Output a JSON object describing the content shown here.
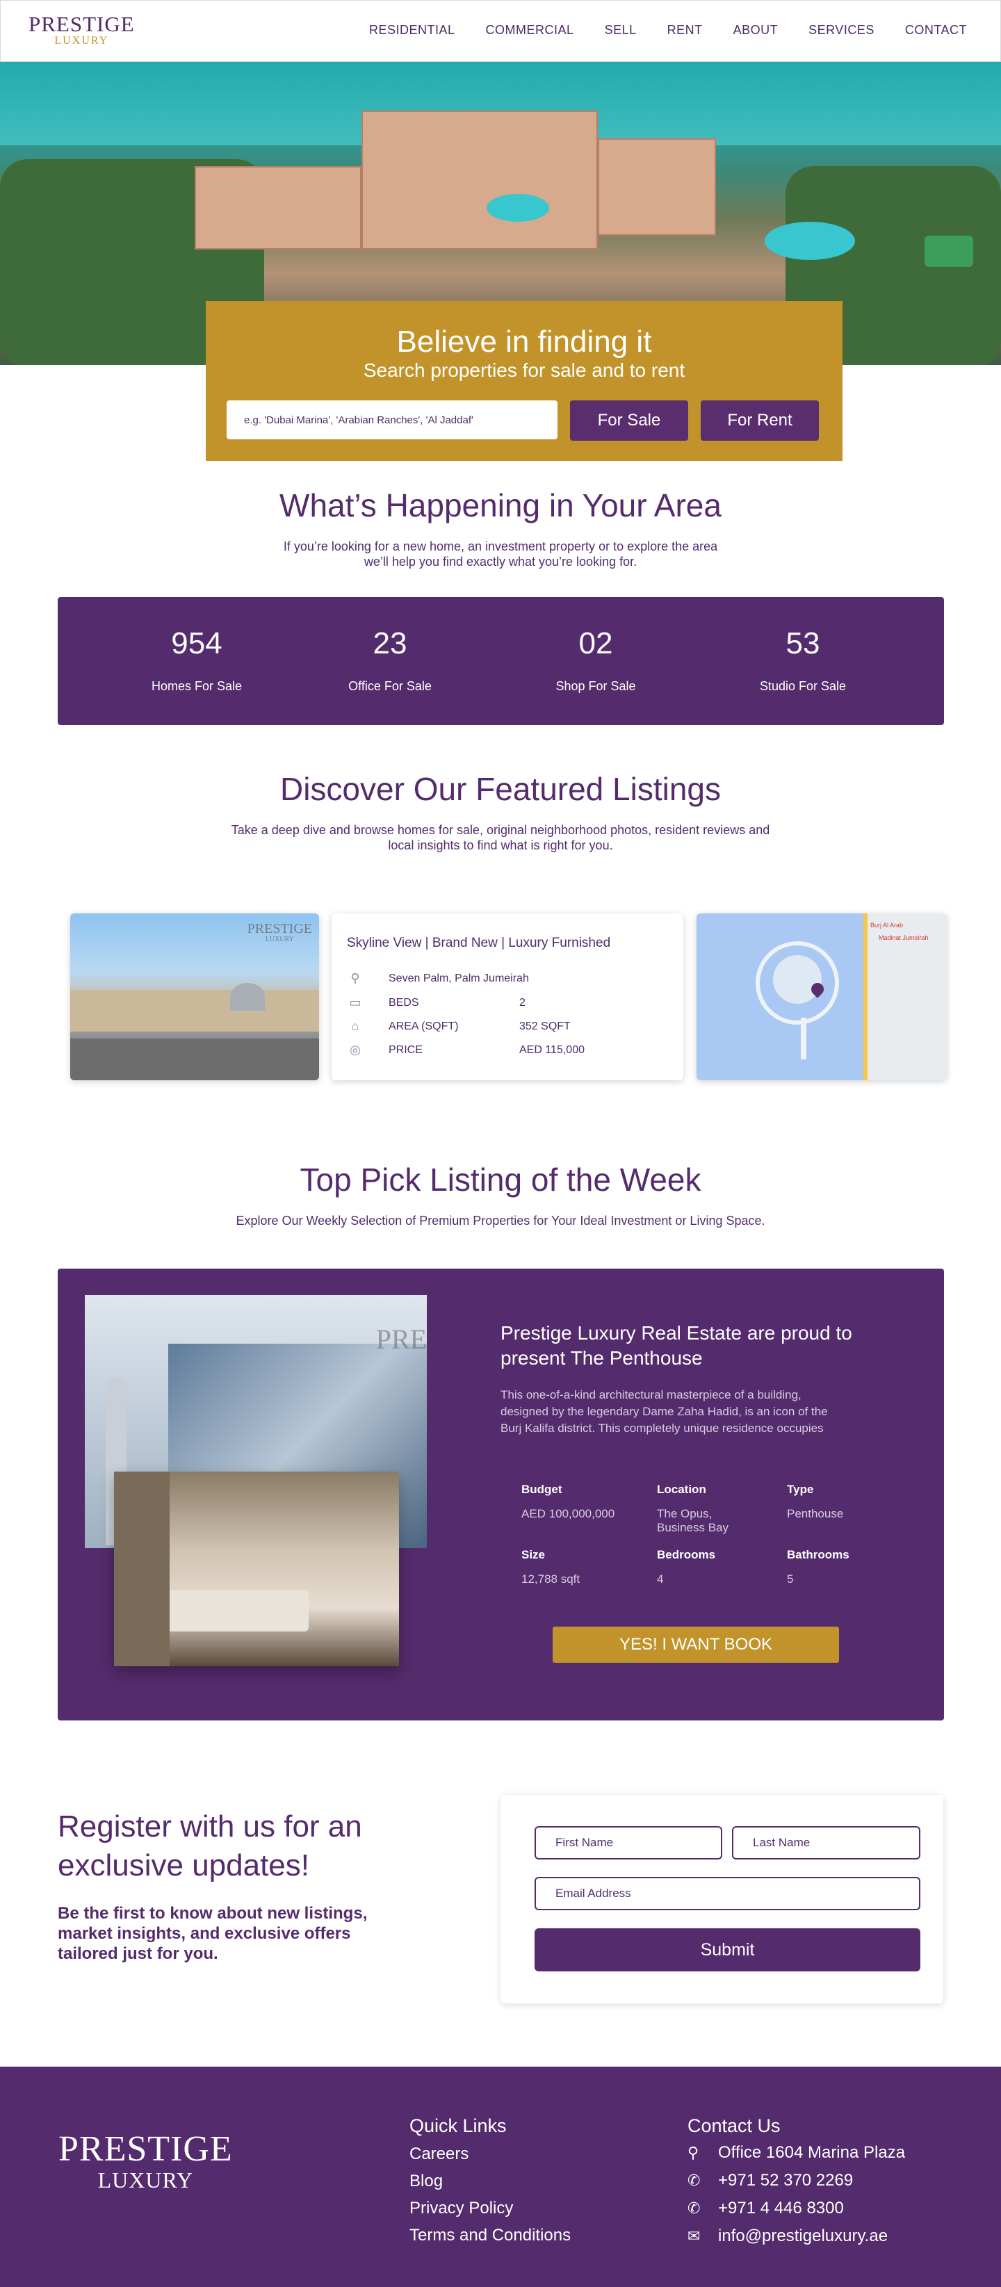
{
  "brand": {
    "logo_top": "PRESTIGE",
    "logo_bottom": "LUXURY"
  },
  "nav": {
    "items": [
      "RESIDENTIAL",
      "COMMERCIAL",
      "SELL",
      "RENT",
      "ABOUT",
      "SERVICES",
      "CONTACT"
    ]
  },
  "hero": {
    "title": "Believe in finding it",
    "subtitle": "Search properties for sale and to rent",
    "search_placeholder": "e.g. 'Dubai Marina', 'Arabian Ranches', 'Al Jaddaf'",
    "for_sale": "For Sale",
    "for_rent": "For Rent"
  },
  "area": {
    "title": "What’s Happening in Your Area",
    "sub1": "If you’re looking for a new home, an investment property or to explore the area",
    "sub2": "we’ll help you find exactly what you’re looking for."
  },
  "stats": [
    {
      "num": "954",
      "label": "Homes For Sale"
    },
    {
      "num": "23",
      "label": "Office For Sale"
    },
    {
      "num": "02",
      "label": "Shop For Sale"
    },
    {
      "num": "53",
      "label": "Studio For Sale"
    }
  ],
  "featured": {
    "title": "Discover Our Featured Listings",
    "sub1": "Take a deep dive and browse homes for sale, original neighborhood photos, resident reviews and",
    "sub2": "local insights to find what is right for you.",
    "watermark_top": "PRESTIGE",
    "watermark_bottom": "LUXURY",
    "listing_title": "Skyline View | Brand New | Luxury Furnished",
    "location": "Seven Palm, Palm Jumeirah",
    "beds_label": "BEDS",
    "beds_value": "2",
    "area_label": "AREA (SQFT)",
    "area_value": "352 SQFT",
    "price_label": "PRICE",
    "price_value": "AED 115,000",
    "map_labels": [
      "Madinat Jumeirah",
      "Burj Al Arab"
    ]
  },
  "toppick": {
    "title": "Top Pick Listing of the Week",
    "sub": "Explore Our Weekly Selection of Premium Properties for Your Ideal Investment or Living Space.",
    "heading1": "Prestige Luxury Real Estate are proud to",
    "heading2": "present The Penthouse",
    "desc1": "This one-of-a-kind architectural masterpiece of a building,",
    "desc2": "designed by the legendary Dame Zaha Hadid, is an icon of the",
    "desc3": "Burj Kalifa district. This completely unique residence occupies",
    "budget_k": "Budget",
    "budget_v": "AED 100,000,000",
    "location_k": "Location",
    "location_v1": "The Opus,",
    "location_v2": "Business Bay",
    "type_k": "Type",
    "type_v": "Penthouse",
    "size_k": "Size",
    "size_v": "12,788 sqft",
    "bedrooms_k": "Bedrooms",
    "bedrooms_v": "4",
    "bathrooms_k": "Bathrooms",
    "bathrooms_v": "5",
    "watermark": "PRE",
    "cta": "YES! I WANT BOOK"
  },
  "register": {
    "title1": "Register with us for an",
    "title2": "exclusive updates!",
    "sub1": "Be the first to know about new listings,",
    "sub2": "market insights, and exclusive offers",
    "sub3": "tailored just for you.",
    "first_name": "First Name",
    "last_name": "Last Name",
    "email": "Email Address",
    "submit": "Submit"
  },
  "footer": {
    "logo_top": "PRESTIGE",
    "logo_bottom": "LUXURY",
    "quick_title": "Quick Links",
    "links": [
      "Careers",
      "Blog",
      "Privacy Policy",
      "Terms and Conditions"
    ],
    "contact_title": "Contact Us",
    "address": "Office 1604 Marina Plaza",
    "phone1": "+971 52 370 2269",
    "phone2": "+971 4 446 8300",
    "email": "info@prestigeluxury.ae"
  },
  "colors": {
    "purple": "#542b6c",
    "gold": "#c1932a"
  }
}
